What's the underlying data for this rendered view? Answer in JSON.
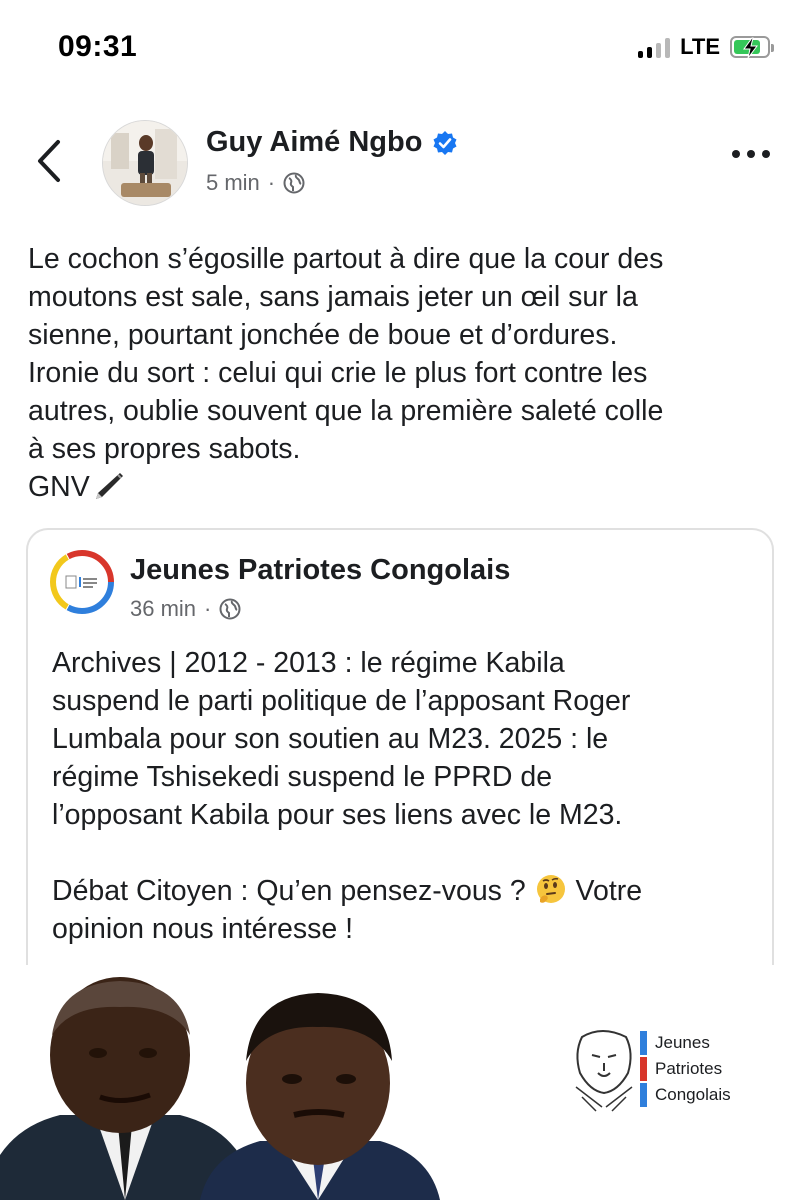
{
  "status_bar": {
    "time": "09:31",
    "network": "LTE",
    "battery_level": 0.8,
    "battery_charging": true
  },
  "post": {
    "author": "Guy Aimé Ngbo",
    "verified": true,
    "time": "5 min",
    "separator": "·",
    "audience_icon": "globe-icon",
    "text_lines": [
      "Le cochon s’égosille partout à dire que la cour des",
      "moutons est sale, sans jamais jeter un œil sur la",
      "sienne, pourtant jonchée de boue et d’ordures.",
      "Ironie du sort : celui qui crie le plus fort contre les",
      "autres, oublie souvent que la première saleté colle",
      "à ses propres sabots."
    ],
    "signature": "GNV",
    "signature_emoji": "pen-icon"
  },
  "shared": {
    "page_name": "Jeunes Patriotes Congolais",
    "time": "36 min",
    "separator": "·",
    "text_lines": [
      "Archives | 2012 - 2013 : le régime Kabila",
      "suspend le parti politique de l’apposant Roger",
      "Lumbala pour son soutien au M23. 2025 : le",
      "régime Tshisekedi suspend le PPRD de",
      "l’opposant Kabila pour ses liens avec le M23."
    ],
    "question_prefix": "Débat Citoyen : Qu’en pensez-vous ?",
    "question_suffix": "Votre",
    "question_line2": "opinion nous intéresse !",
    "image": {
      "logo_lines": [
        "Jeunes",
        "Patriotes",
        "Congolais"
      ],
      "logo_colors": [
        "#2f7fdc",
        "#d8362b",
        "#2f7fdc"
      ]
    }
  },
  "colors": {
    "text": "#1c1e21",
    "meta": "#65676b",
    "verified_blue": "#1877f2",
    "flag_blue": "#2f7fdc",
    "flag_yellow": "#f2c81c",
    "flag_red": "#d8362b"
  }
}
